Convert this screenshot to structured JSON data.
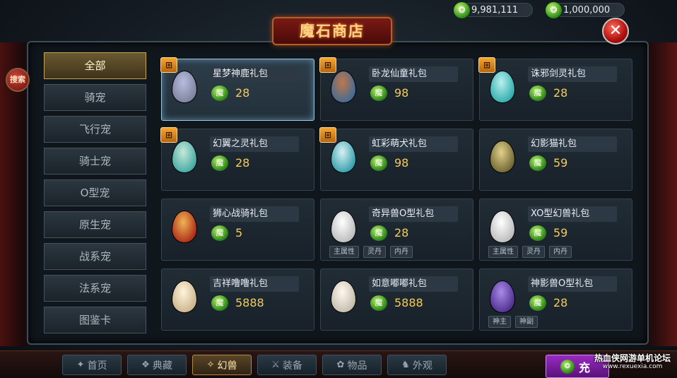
{
  "currency": {
    "gold_coin": "9,981,111",
    "bound_coin": "1,000,000",
    "icon": "green-coin-icon"
  },
  "shop_title": "魔石商店",
  "close_icon": "✕",
  "search_label": "搜索",
  "categories": [
    {
      "label": "全部"
    },
    {
      "label": "骑宠"
    },
    {
      "label": "飞行宠"
    },
    {
      "label": "骑士宠"
    },
    {
      "label": "O型宠"
    },
    {
      "label": "原生宠"
    },
    {
      "label": "战系宠"
    },
    {
      "label": "法系宠"
    },
    {
      "label": "图鉴卡"
    }
  ],
  "new_badge": "new",
  "price_icon_text": "魔",
  "items": [
    {
      "name": "星梦神鹿礼包",
      "price": "28",
      "new": true,
      "colors": [
        "#7a7f9a",
        "#b8bde0"
      ]
    },
    {
      "name": "卧龙仙童礼包",
      "price": "98",
      "new": true,
      "colors": [
        "#3a6a9a",
        "#c0784a"
      ]
    },
    {
      "name": "诛邪剑灵礼包",
      "price": "28",
      "new": true,
      "colors": [
        "#2aa8a8",
        "#b8f0f0"
      ]
    },
    {
      "name": "幻翼之灵礼包",
      "price": "28",
      "new": true,
      "colors": [
        "#3aa6a0",
        "#c8e8d8"
      ]
    },
    {
      "name": "虹彩萌犬礼包",
      "price": "98",
      "new": true,
      "colors": [
        "#2a9aa6",
        "#d8f0f4"
      ]
    },
    {
      "name": "幻影猫礼包",
      "price": "59",
      "new": false,
      "colors": [
        "#6a6030",
        "#e0d088"
      ]
    },
    {
      "name": "狮心战骑礼包",
      "price": "5",
      "new": false,
      "colors": [
        "#a82414",
        "#f0b454"
      ]
    },
    {
      "name": "奇异兽O型礼包",
      "price": "28",
      "new": false,
      "colors": [
        "#b8b8b8",
        "#ffffff"
      ],
      "tags": [
        "主属性",
        "灵丹",
        "内丹"
      ]
    },
    {
      "name": "XO型幻兽礼包",
      "price": "59",
      "new": false,
      "colors": [
        "#b8b8b8",
        "#ffffff"
      ],
      "tags": [
        "主属性",
        "灵丹",
        "内丹"
      ]
    },
    {
      "name": "吉祥噜噜礼包",
      "price": "5888",
      "new": false,
      "colors": [
        "#c8b088",
        "#fff4dc"
      ]
    },
    {
      "name": "如意嘟嘟礼包",
      "price": "5888",
      "new": false,
      "colors": [
        "#c0b8a8",
        "#fff8ee"
      ]
    },
    {
      "name": "神影兽O型礼包",
      "price": "28",
      "new": false,
      "colors": [
        "#4a2a8a",
        "#a88ae8"
      ],
      "tags": [
        "神主",
        "神副"
      ]
    }
  ],
  "bottom_nav": [
    {
      "label": "首页",
      "icon": "✦"
    },
    {
      "label": "典藏",
      "icon": "❖"
    },
    {
      "label": "幻兽",
      "icon": "✧"
    },
    {
      "label": "装备",
      "icon": "⚔"
    },
    {
      "label": "物品",
      "icon": "✿"
    },
    {
      "label": "外观",
      "icon": "♞"
    }
  ],
  "recharge_label": "充",
  "watermark": {
    "line1": "热血侠网游单机论坛",
    "line2": "www.rexuexia.com"
  }
}
